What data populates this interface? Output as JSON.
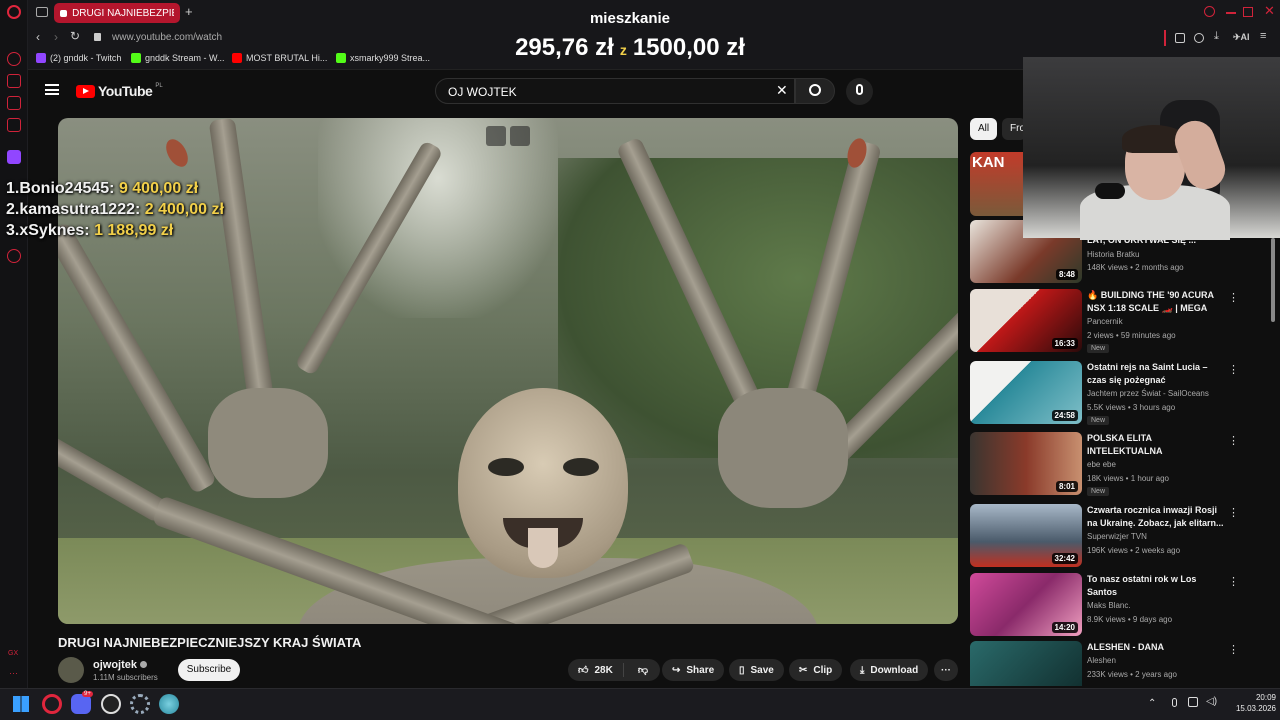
{
  "browser": {
    "tab_title": "DRUGI NAJNIEBEZPIECZNI",
    "url": "www.youtube.com/watch",
    "bookmarks": [
      {
        "label": "(2) gnddk - Twitch",
        "color": "#9146ff"
      },
      {
        "label": "gnddk Stream - W...",
        "color": "#53fc18"
      },
      {
        "label": "MOST BRUTAL Hi...",
        "color": "#ff0000"
      },
      {
        "label": "xsmarky999 Strea...",
        "color": "#53fc18"
      }
    ],
    "toolbar_ai": "AI"
  },
  "overlay": {
    "goal_title": "mieszkanie",
    "current": "295,76 zł",
    "separator": "z",
    "target": "1500,00 zł",
    "leaderboard": [
      {
        "rank": "1.",
        "name": "Bonio24545:",
        "amount": "9 400,00 zł"
      },
      {
        "rank": "2.",
        "name": "kamasutra1222:",
        "amount": "2 400,00 zł"
      },
      {
        "rank": "3.",
        "name": "xSyknes:",
        "amount": "1 188,99 zł"
      }
    ]
  },
  "youtube": {
    "logo": "YouTube",
    "region": "PL",
    "search_query": "OJ WOJTEK",
    "video_title": "DRUGI NAJNIEBEZPIECZNIEJSZY KRAJ ŚWIATA",
    "channel": {
      "name": "ojwojtek",
      "subs": "1.11M subscribers"
    },
    "subscribe": "Subscribe",
    "actions": {
      "likes": "28K",
      "share": "Share",
      "save": "Save",
      "clip": "Clip",
      "download": "Download"
    },
    "chips": [
      "All",
      "Fro"
    ],
    "recommendations": [
      {
        "title": "LAT, ON UKRYWAŁ SIĘ ...",
        "channel": "Historia Bratku",
        "meta": "148K views • 2 months ago",
        "duration": "8:48",
        "badge": "",
        "thumb": "#7a3a2a"
      },
      {
        "title": "🔥 BUILDING THE '90 ACURA NSX 1:18 SCALE 🏎️ | MEGA HO...",
        "channel": "Pancernik",
        "meta": "2 views • 59 minutes ago",
        "duration": "16:33",
        "badge": "New",
        "thumb": "#c01818"
      },
      {
        "title": "Ostatni rejs na Saint Lucia – czas się pożegnać",
        "channel": "Jachtem przez Świat - SailOceans",
        "meta": "5.5K views • 3 hours ago",
        "duration": "24:58",
        "badge": "New",
        "thumb": "#2a8a9a"
      },
      {
        "title": "POLSKA ELITA INTELEKTUALNA",
        "channel": "ebe ebe",
        "meta": "18K views • 1 hour ago",
        "duration": "8:01",
        "badge": "New",
        "thumb": "#8a3a2a"
      },
      {
        "title": "Czwarta rocznica inwazji Rosji na Ukrainę. Zobacz, jak elitarn...",
        "channel": "Superwizjer TVN",
        "meta": "196K views • 2 weeks ago",
        "duration": "32:42",
        "badge": "",
        "thumb": "#4a5a6a"
      },
      {
        "title": "To nasz ostatni rok w Los Santos",
        "channel": "Maks Blanc.",
        "meta": "8.9K views • 9 days ago",
        "duration": "14:20",
        "badge": "",
        "thumb": "#c0408a"
      },
      {
        "title": "ALESHEN - DANA",
        "channel": "Aleshen",
        "meta": "233K views • 2 years ago",
        "duration": "",
        "badge": "",
        "thumb": "#1f4a4a"
      }
    ],
    "partial_thumb_text": "KAN"
  },
  "taskbar": {
    "time": "20:09",
    "date": "15.03.2026",
    "discord_badge": "9+"
  }
}
